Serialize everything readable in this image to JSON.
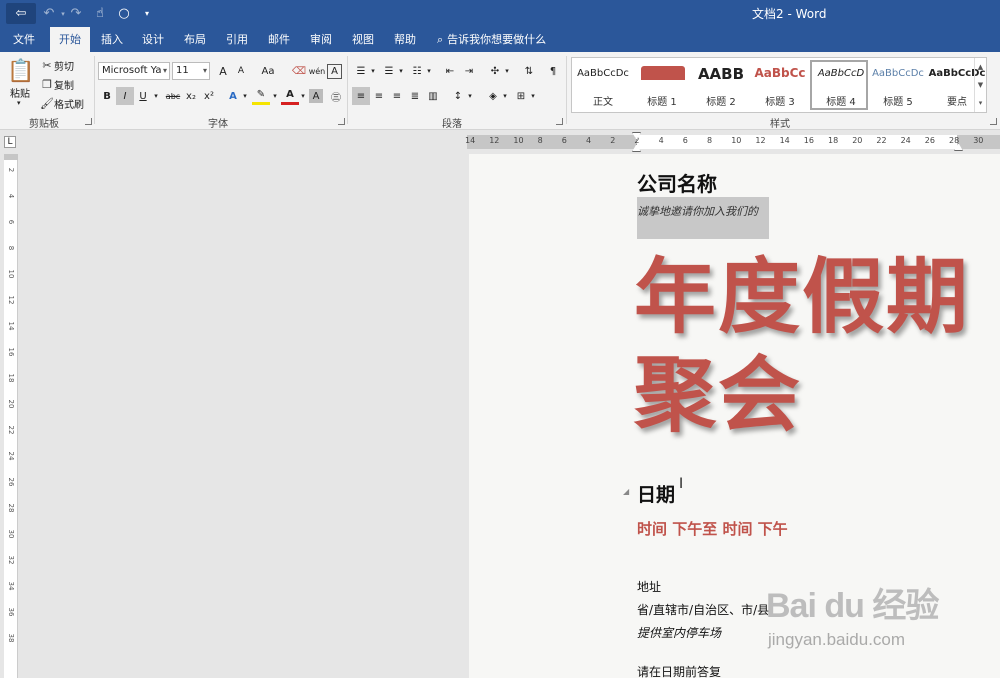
{
  "window": {
    "title": "文档2 - Word"
  },
  "titlebar": {
    "undo_icon": "undo-icon",
    "redo_icon": "redo-icon",
    "touch_icon": "touch-mode-icon",
    "more_icon": "customize-icon"
  },
  "tabs": [
    {
      "label": "文件"
    },
    {
      "label": "开始"
    },
    {
      "label": "插入"
    },
    {
      "label": "设计"
    },
    {
      "label": "布局"
    },
    {
      "label": "引用"
    },
    {
      "label": "邮件"
    },
    {
      "label": "审阅"
    },
    {
      "label": "视图"
    },
    {
      "label": "帮助"
    }
  ],
  "tellme": {
    "placeholder": "告诉我你想要做什么"
  },
  "clipboard": {
    "paste": "粘贴",
    "cut": "剪切",
    "copy": "复制",
    "format_painter": "格式刷",
    "group_label": "剪贴板"
  },
  "font": {
    "font_name": "Microsoft Ya",
    "font_size": "11",
    "group_label": "字体",
    "bold": "B",
    "italic": "I",
    "underline": "U",
    "strikethrough": "abc",
    "subscript": "x₂",
    "superscript": "x²",
    "change_case": "Aa",
    "phonetic": "wén",
    "grow": "A",
    "shrink": "A"
  },
  "paragraph": {
    "group_label": "段落"
  },
  "styles": {
    "group_label": "样式",
    "items": [
      {
        "sample": "AaBbCcDc",
        "name": "正文"
      },
      {
        "sample": "AaBl",
        "name": "标题 1"
      },
      {
        "sample": "AABB",
        "name": "标题 2"
      },
      {
        "sample": "AaBbCc",
        "name": "标题 3"
      },
      {
        "sample": "AaBbCcD",
        "name": "标题 4"
      },
      {
        "sample": "AaBbCcDc",
        "name": "标题 5"
      },
      {
        "sample": "AaBbCcDc",
        "name": "要点"
      }
    ]
  },
  "ruler": {
    "h_numbers": [
      "14",
      "12",
      "10",
      "8",
      "6",
      "4",
      "2",
      "2",
      "4",
      "6",
      "8",
      "10",
      "12",
      "14",
      "16",
      "18",
      "20",
      "22",
      "24",
      "26",
      "28",
      "30"
    ],
    "v_numbers": [
      "2",
      "4",
      "6",
      "8",
      "10",
      "12",
      "14",
      "16",
      "18",
      "20",
      "22",
      "24",
      "26",
      "28",
      "30",
      "32",
      "34",
      "36",
      "38"
    ]
  },
  "document": {
    "company": "公司名称",
    "invite": "诚挚地邀请你加入我们的",
    "headline_line1": "年度假期",
    "headline_line2": "聚会",
    "date_heading": "日期",
    "time_line": "时间 下午至 时间 下午",
    "address_label": "地址",
    "address_value": "省/直辖市/自治区、市/县",
    "parking": "提供室内停车场",
    "rsvp": "请在日期前答复"
  },
  "watermark": {
    "main": "Bai du 经验",
    "sub": "jingyan.baidu.com"
  },
  "colors": {
    "word_blue": "#2b579a",
    "headline_red": "#c0534b",
    "ribbon_bg": "#f3f3f3"
  }
}
